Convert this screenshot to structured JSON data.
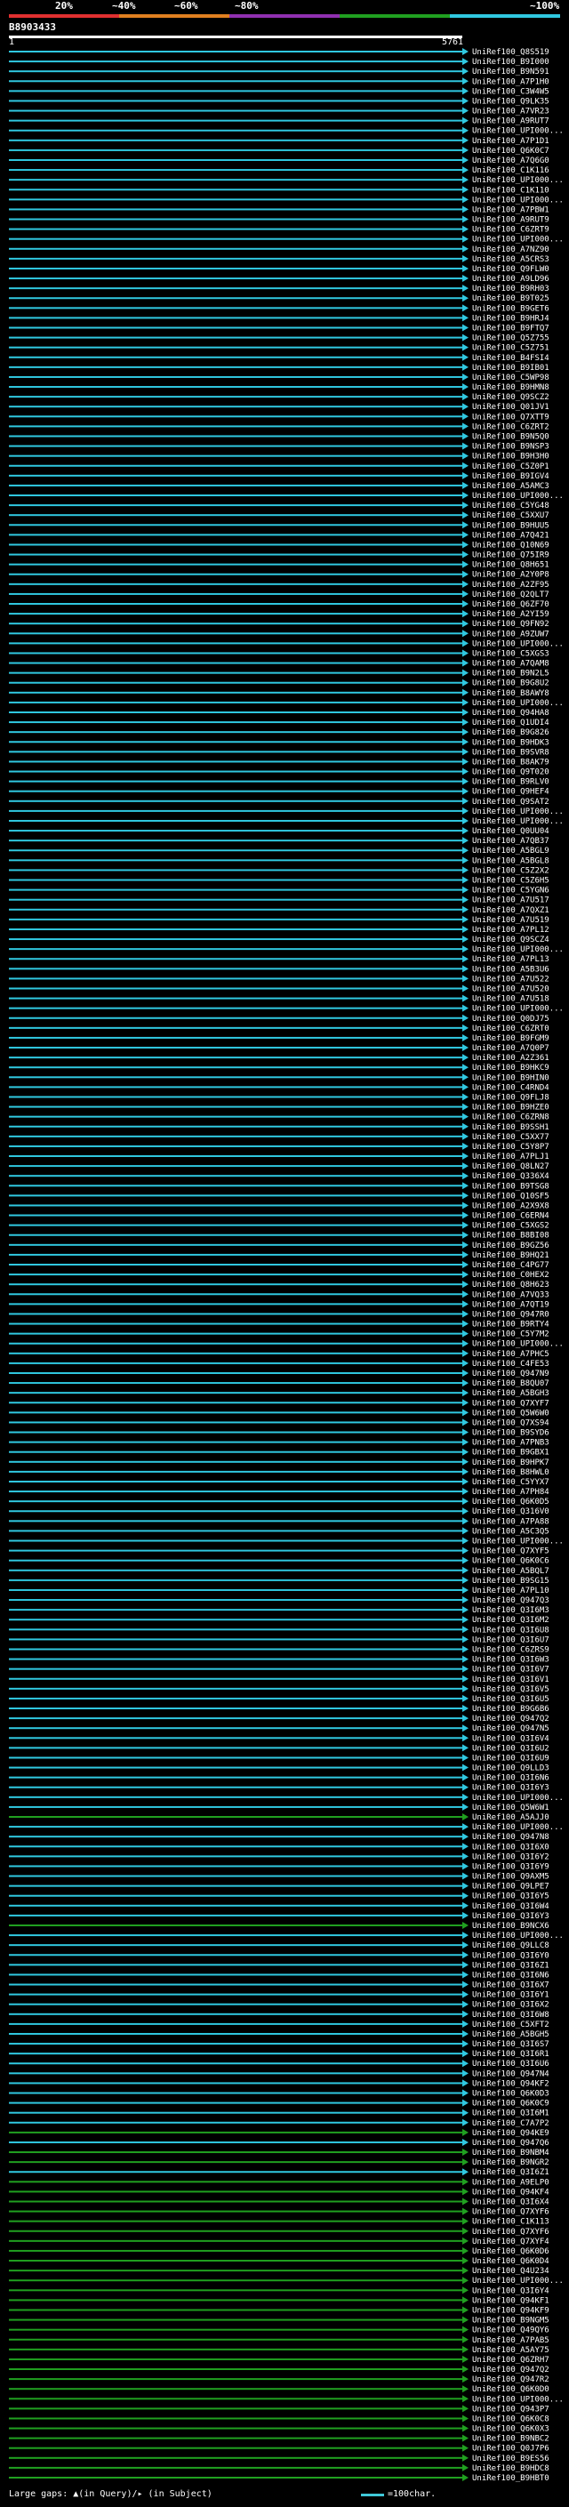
{
  "legend": {
    "labels": [
      "20%",
      "~40%",
      "~60%",
      "~80%",
      "~100%"
    ],
    "colors": [
      "#e03030",
      "#e08020",
      "#9030b0",
      "#20a020",
      "#30c8e0"
    ]
  },
  "query_id": "B8903433",
  "ruler": {
    "start": "1",
    "end": "5761"
  },
  "footer": {
    "caption": "Large gaps: ▲(in Query)/▸ (in Subject)",
    "scale": "=100char."
  },
  "chart_data": {
    "type": "alignment",
    "query_length": 5761,
    "identity_classes": {
      "cyan": "~100%",
      "green": "~80%"
    },
    "hits": [
      {
        "id": "UniRef100_Q8S519",
        "c": "cyan"
      },
      {
        "id": "UniRef100_B9I000",
        "c": "cyan"
      },
      {
        "id": "UniRef100_B9N591",
        "c": "cyan"
      },
      {
        "id": "UniRef100_A7P1H0",
        "c": "cyan"
      },
      {
        "id": "UniRef100_C3W4W5",
        "c": "cyan"
      },
      {
        "id": "UniRef100_Q9LK35",
        "c": "cyan"
      },
      {
        "id": "UniRef100_A7VR23",
        "c": "cyan"
      },
      {
        "id": "UniRef100_A9RUT7",
        "c": "cyan"
      },
      {
        "id": "UniRef100_UPI000...",
        "c": "cyan"
      },
      {
        "id": "UniRef100_A7P1D1",
        "c": "cyan"
      },
      {
        "id": "UniRef100_Q6K0C7",
        "c": "cyan"
      },
      {
        "id": "UniRef100_A7Q6G0",
        "c": "cyan"
      },
      {
        "id": "UniRef100_C1K116",
        "c": "cyan"
      },
      {
        "id": "UniRef100_UPI000...",
        "c": "cyan"
      },
      {
        "id": "UniRef100_C1K110",
        "c": "cyan"
      },
      {
        "id": "UniRef100_UPI000...",
        "c": "cyan"
      },
      {
        "id": "UniRef100_A7PBW1",
        "c": "cyan"
      },
      {
        "id": "UniRef100_A9RUT9",
        "c": "cyan"
      },
      {
        "id": "UniRef100_C6ZRT9",
        "c": "cyan"
      },
      {
        "id": "UniRef100_UPI000...",
        "c": "cyan"
      },
      {
        "id": "UniRef100_A7NZ90",
        "c": "cyan"
      },
      {
        "id": "UniRef100_A5CRS3",
        "c": "cyan"
      },
      {
        "id": "UniRef100_Q9FLW0",
        "c": "cyan"
      },
      {
        "id": "UniRef100_A9LD96",
        "c": "cyan"
      },
      {
        "id": "UniRef100_B9RH03",
        "c": "cyan"
      },
      {
        "id": "UniRef100_B9T025",
        "c": "cyan"
      },
      {
        "id": "UniRef100_B9GET6",
        "c": "cyan"
      },
      {
        "id": "UniRef100_B9HRJ4",
        "c": "cyan"
      },
      {
        "id": "UniRef100_B9FTQ7",
        "c": "cyan"
      },
      {
        "id": "UniRef100_Q5Z755",
        "c": "cyan"
      },
      {
        "id": "UniRef100_C5Z751",
        "c": "cyan"
      },
      {
        "id": "UniRef100_B4FSI4",
        "c": "cyan"
      },
      {
        "id": "UniRef100_B9IB01",
        "c": "cyan"
      },
      {
        "id": "UniRef100_C5WP98",
        "c": "cyan"
      },
      {
        "id": "UniRef100_B9HMN8",
        "c": "cyan"
      },
      {
        "id": "UniRef100_Q9SCZ2",
        "c": "cyan"
      },
      {
        "id": "UniRef100_Q01JV1",
        "c": "cyan"
      },
      {
        "id": "UniRef100_Q7XTT9",
        "c": "cyan"
      },
      {
        "id": "UniRef100_C6ZRT2",
        "c": "cyan"
      },
      {
        "id": "UniRef100_B9N5Q0",
        "c": "cyan"
      },
      {
        "id": "UniRef100_B9NSP3",
        "c": "cyan"
      },
      {
        "id": "UniRef100_B9H3H0",
        "c": "cyan"
      },
      {
        "id": "UniRef100_C5Z0P1",
        "c": "cyan"
      },
      {
        "id": "UniRef100_B9IGV4",
        "c": "cyan"
      },
      {
        "id": "UniRef100_A5AMC3",
        "c": "cyan"
      },
      {
        "id": "UniRef100_UPI000...",
        "c": "cyan"
      },
      {
        "id": "UniRef100_C5YG48",
        "c": "cyan"
      },
      {
        "id": "UniRef100_C5XXU7",
        "c": "cyan"
      },
      {
        "id": "UniRef100_B9HUU5",
        "c": "cyan"
      },
      {
        "id": "UniRef100_A7Q421",
        "c": "cyan"
      },
      {
        "id": "UniRef100_Q10N69",
        "c": "cyan"
      },
      {
        "id": "UniRef100_Q75IR9",
        "c": "cyan"
      },
      {
        "id": "UniRef100_Q8H651",
        "c": "cyan"
      },
      {
        "id": "UniRef100_A2Y0P8",
        "c": "cyan"
      },
      {
        "id": "UniRef100_A2ZF95",
        "c": "cyan"
      },
      {
        "id": "UniRef100_Q2QLT7",
        "c": "cyan"
      },
      {
        "id": "UniRef100_Q6ZF70",
        "c": "cyan"
      },
      {
        "id": "UniRef100_A2YI59",
        "c": "cyan"
      },
      {
        "id": "UniRef100_Q9FN92",
        "c": "cyan"
      },
      {
        "id": "UniRef100_A9ZUW7",
        "c": "cyan"
      },
      {
        "id": "UniRef100_UPI000...",
        "c": "cyan"
      },
      {
        "id": "UniRef100_C5XGS3",
        "c": "cyan"
      },
      {
        "id": "UniRef100_A7QAM8",
        "c": "cyan"
      },
      {
        "id": "UniRef100_B9N2L5",
        "c": "cyan"
      },
      {
        "id": "UniRef100_B9G8U2",
        "c": "cyan"
      },
      {
        "id": "UniRef100_B8AWY8",
        "c": "cyan"
      },
      {
        "id": "UniRef100_UPI000...",
        "c": "cyan"
      },
      {
        "id": "UniRef100_Q94HA8",
        "c": "cyan"
      },
      {
        "id": "UniRef100_Q1UDI4",
        "c": "cyan"
      },
      {
        "id": "UniRef100_B9G826",
        "c": "cyan"
      },
      {
        "id": "UniRef100_B9HDK3",
        "c": "cyan"
      },
      {
        "id": "UniRef100_B9SVR8",
        "c": "cyan"
      },
      {
        "id": "UniRef100_B8AK79",
        "c": "cyan"
      },
      {
        "id": "UniRef100_Q9T020",
        "c": "cyan"
      },
      {
        "id": "UniRef100_B9RLV0",
        "c": "cyan"
      },
      {
        "id": "UniRef100_Q9HEF4",
        "c": "cyan"
      },
      {
        "id": "UniRef100_Q9SAT2",
        "c": "cyan"
      },
      {
        "id": "UniRef100_UPI000...",
        "c": "cyan"
      },
      {
        "id": "UniRef100_UPI000...",
        "c": "cyan"
      },
      {
        "id": "UniRef100_Q0UU04",
        "c": "cyan"
      },
      {
        "id": "UniRef100_A7QB37",
        "c": "cyan"
      },
      {
        "id": "UniRef100_A5BGL9",
        "c": "cyan"
      },
      {
        "id": "UniRef100_A5BGL8",
        "c": "cyan"
      },
      {
        "id": "UniRef100_C5Z2X2",
        "c": "cyan"
      },
      {
        "id": "UniRef100_C5Z6H5",
        "c": "cyan"
      },
      {
        "id": "UniRef100_C5YGN6",
        "c": "cyan"
      },
      {
        "id": "UniRef100_A7U517",
        "c": "cyan"
      },
      {
        "id": "UniRef100_A7QXZ1",
        "c": "cyan"
      },
      {
        "id": "UniRef100_A7U519",
        "c": "cyan"
      },
      {
        "id": "UniRef100_A7PL12",
        "c": "cyan"
      },
      {
        "id": "UniRef100_Q9SCZ4",
        "c": "cyan"
      },
      {
        "id": "UniRef100_UPI000...",
        "c": "cyan"
      },
      {
        "id": "UniRef100_A7PL13",
        "c": "cyan"
      },
      {
        "id": "UniRef100_A5B3U6",
        "c": "cyan"
      },
      {
        "id": "UniRef100_A7U522",
        "c": "cyan"
      },
      {
        "id": "UniRef100_A7U520",
        "c": "cyan"
      },
      {
        "id": "UniRef100_A7U518",
        "c": "cyan"
      },
      {
        "id": "UniRef100_UPI000...",
        "c": "cyan"
      },
      {
        "id": "UniRef100_Q0DJ75",
        "c": "cyan"
      },
      {
        "id": "UniRef100_C6ZRT0",
        "c": "cyan"
      },
      {
        "id": "UniRef100_B9FGM9",
        "c": "cyan"
      },
      {
        "id": "UniRef100_A7Q0P7",
        "c": "cyan"
      },
      {
        "id": "UniRef100_A2Z361",
        "c": "cyan"
      },
      {
        "id": "UniRef100_B9HKC9",
        "c": "cyan"
      },
      {
        "id": "UniRef100_B9HIN0",
        "c": "cyan"
      },
      {
        "id": "UniRef100_C4RND4",
        "c": "cyan"
      },
      {
        "id": "UniRef100_Q9FLJ8",
        "c": "cyan"
      },
      {
        "id": "UniRef100_B9HZE0",
        "c": "cyan"
      },
      {
        "id": "UniRef100_C6ZRN8",
        "c": "cyan"
      },
      {
        "id": "UniRef100_B9SSH1",
        "c": "cyan"
      },
      {
        "id": "UniRef100_C5XX77",
        "c": "cyan"
      },
      {
        "id": "UniRef100_C5Y8P7",
        "c": "cyan"
      },
      {
        "id": "UniRef100_A7PLJ1",
        "c": "cyan"
      },
      {
        "id": "UniRef100_Q8LN27",
        "c": "cyan"
      },
      {
        "id": "UniRef100_Q336X4",
        "c": "cyan"
      },
      {
        "id": "UniRef100_B9TSG8",
        "c": "cyan"
      },
      {
        "id": "UniRef100_Q10SF5",
        "c": "cyan"
      },
      {
        "id": "UniRef100_A2X9X8",
        "c": "cyan"
      },
      {
        "id": "UniRef100_C6ERN4",
        "c": "cyan"
      },
      {
        "id": "UniRef100_C5XGS2",
        "c": "cyan"
      },
      {
        "id": "UniRef100_B8BI08",
        "c": "cyan"
      },
      {
        "id": "UniRef100_B9GZ56",
        "c": "cyan"
      },
      {
        "id": "UniRef100_B9HQ21",
        "c": "cyan"
      },
      {
        "id": "UniRef100_C4PG77",
        "c": "cyan"
      },
      {
        "id": "UniRef100_C0HEX2",
        "c": "cyan"
      },
      {
        "id": "UniRef100_Q8H623",
        "c": "cyan"
      },
      {
        "id": "UniRef100_A7VQ33",
        "c": "cyan"
      },
      {
        "id": "UniRef100_A7QT19",
        "c": "cyan"
      },
      {
        "id": "UniRef100_Q947R0",
        "c": "cyan"
      },
      {
        "id": "UniRef100_B9RTY4",
        "c": "cyan"
      },
      {
        "id": "UniRef100_C5Y7M2",
        "c": "cyan"
      },
      {
        "id": "UniRef100_UPI000...",
        "c": "cyan"
      },
      {
        "id": "UniRef100_A7PHC5",
        "c": "cyan"
      },
      {
        "id": "UniRef100_C4FE53",
        "c": "cyan"
      },
      {
        "id": "UniRef100_Q947N9",
        "c": "cyan"
      },
      {
        "id": "UniRef100_B8QU07",
        "c": "cyan"
      },
      {
        "id": "UniRef100_A5BGH3",
        "c": "cyan"
      },
      {
        "id": "UniRef100_Q7XYF7",
        "c": "cyan"
      },
      {
        "id": "UniRef100_Q5W6W0",
        "c": "cyan"
      },
      {
        "id": "UniRef100_Q7XS94",
        "c": "cyan"
      },
      {
        "id": "UniRef100_B9SYD6",
        "c": "cyan"
      },
      {
        "id": "UniRef100_A7PNB3",
        "c": "cyan"
      },
      {
        "id": "UniRef100_B9GBX1",
        "c": "cyan"
      },
      {
        "id": "UniRef100_B9HPK7",
        "c": "cyan"
      },
      {
        "id": "UniRef100_B8HWL0",
        "c": "cyan"
      },
      {
        "id": "UniRef100_C5YYX7",
        "c": "cyan"
      },
      {
        "id": "UniRef100_A7PH84",
        "c": "cyan"
      },
      {
        "id": "UniRef100_Q6K0D5",
        "c": "cyan"
      },
      {
        "id": "UniRef100_Q316V0",
        "c": "cyan"
      },
      {
        "id": "UniRef100_A7PA88",
        "c": "cyan"
      },
      {
        "id": "UniRef100_A5C3Q5",
        "c": "cyan"
      },
      {
        "id": "UniRef100_UPI000...",
        "c": "cyan"
      },
      {
        "id": "UniRef100_Q7XYF5",
        "c": "cyan"
      },
      {
        "id": "UniRef100_Q6K0C6",
        "c": "cyan"
      },
      {
        "id": "UniRef100_A5BQL7",
        "c": "cyan"
      },
      {
        "id": "UniRef100_B9SG15",
        "c": "cyan"
      },
      {
        "id": "UniRef100_A7PL10",
        "c": "cyan"
      },
      {
        "id": "UniRef100_Q947Q3",
        "c": "cyan"
      },
      {
        "id": "UniRef100_Q3I6M3",
        "c": "cyan"
      },
      {
        "id": "UniRef100_Q3I6M2",
        "c": "cyan"
      },
      {
        "id": "UniRef100_Q3I6U8",
        "c": "cyan"
      },
      {
        "id": "UniRef100_Q3I6U7",
        "c": "cyan"
      },
      {
        "id": "UniRef100_C6ZRS9",
        "c": "cyan"
      },
      {
        "id": "UniRef100_Q3I6W3",
        "c": "cyan"
      },
      {
        "id": "UniRef100_Q3I6V7",
        "c": "cyan"
      },
      {
        "id": "UniRef100_Q3I6V1",
        "c": "cyan"
      },
      {
        "id": "UniRef100_Q3I6V5",
        "c": "cyan"
      },
      {
        "id": "UniRef100_Q3I6U5",
        "c": "cyan"
      },
      {
        "id": "UniRef100_B9G6B6",
        "c": "cyan"
      },
      {
        "id": "UniRef100_Q947Q2",
        "c": "cyan"
      },
      {
        "id": "UniRef100_Q947N5",
        "c": "cyan"
      },
      {
        "id": "UniRef100_Q3I6V4",
        "c": "cyan"
      },
      {
        "id": "UniRef100_Q3I6U2",
        "c": "cyan"
      },
      {
        "id": "UniRef100_Q3I6U9",
        "c": "cyan"
      },
      {
        "id": "UniRef100_Q9LLD3",
        "c": "cyan"
      },
      {
        "id": "UniRef100_Q3I6N6",
        "c": "cyan"
      },
      {
        "id": "UniRef100_Q3I6Y3",
        "c": "cyan"
      },
      {
        "id": "UniRef100_UPI000...",
        "c": "cyan"
      },
      {
        "id": "UniRef100_Q5W6W1",
        "c": "cyan"
      },
      {
        "id": "UniRef100_A5AJJ0",
        "c": "green"
      },
      {
        "id": "UniRef100_UPI000...",
        "c": "cyan"
      },
      {
        "id": "UniRef100_Q947N8",
        "c": "cyan"
      },
      {
        "id": "UniRef100_Q3I6X0",
        "c": "cyan"
      },
      {
        "id": "UniRef100_Q3I6Y2",
        "c": "cyan"
      },
      {
        "id": "UniRef100_Q3I6Y9",
        "c": "cyan"
      },
      {
        "id": "UniRef100_Q9AXM5",
        "c": "cyan"
      },
      {
        "id": "UniRef100_Q9LPE7",
        "c": "cyan"
      },
      {
        "id": "UniRef100_Q3I6Y5",
        "c": "cyan"
      },
      {
        "id": "UniRef100_Q3I6W4",
        "c": "cyan"
      },
      {
        "id": "UniRef100_Q3I6Y3",
        "c": "cyan"
      },
      {
        "id": "UniRef100_B9NCX6",
        "c": "green"
      },
      {
        "id": "UniRef100_UPI000...",
        "c": "cyan"
      },
      {
        "id": "UniRef100_Q9LLC8",
        "c": "cyan"
      },
      {
        "id": "UniRef100_Q3I6Y0",
        "c": "cyan"
      },
      {
        "id": "UniRef100_Q3I6Z1",
        "c": "cyan"
      },
      {
        "id": "UniRef100_Q3I6N6",
        "c": "cyan"
      },
      {
        "id": "UniRef100_Q3I6X7",
        "c": "cyan"
      },
      {
        "id": "UniRef100_Q3I6Y1",
        "c": "cyan"
      },
      {
        "id": "UniRef100_Q3I6X2",
        "c": "cyan"
      },
      {
        "id": "UniRef100_Q3I6W8",
        "c": "cyan"
      },
      {
        "id": "UniRef100_C5XFT2",
        "c": "cyan"
      },
      {
        "id": "UniRef100_A5BGH5",
        "c": "cyan"
      },
      {
        "id": "UniRef100_Q3I6S7",
        "c": "cyan"
      },
      {
        "id": "UniRef100_Q3I6R1",
        "c": "cyan"
      },
      {
        "id": "UniRef100_Q3I6U6",
        "c": "cyan"
      },
      {
        "id": "UniRef100_Q947N4",
        "c": "cyan"
      },
      {
        "id": "UniRef100_Q94KF2",
        "c": "cyan"
      },
      {
        "id": "UniRef100_Q6K0D3",
        "c": "cyan"
      },
      {
        "id": "UniRef100_Q6K0C9",
        "c": "cyan"
      },
      {
        "id": "UniRef100_Q3I6M1",
        "c": "cyan"
      },
      {
        "id": "UniRef100_C7A7P2",
        "c": "cyan"
      },
      {
        "id": "UniRef100_Q94KE9",
        "c": "green"
      },
      {
        "id": "UniRef100_Q947Q6",
        "c": "cyan"
      },
      {
        "id": "UniRef100_B9NBM4",
        "c": "green"
      },
      {
        "id": "UniRef100_B9NGR2",
        "c": "green"
      },
      {
        "id": "UniRef100_Q3I6Z1",
        "c": "cyan"
      },
      {
        "id": "UniRef100_A9ELP0",
        "c": "green"
      },
      {
        "id": "UniRef100_Q94KF4",
        "c": "green"
      },
      {
        "id": "UniRef100_Q3I6X4",
        "c": "green"
      },
      {
        "id": "UniRef100_Q7XYF6",
        "c": "green"
      },
      {
        "id": "UniRef100_C1K113",
        "c": "green"
      },
      {
        "id": "UniRef100_Q7XYF6",
        "c": "green"
      },
      {
        "id": "UniRef100_Q7XYF4",
        "c": "green"
      },
      {
        "id": "UniRef100_Q6K0D6",
        "c": "green"
      },
      {
        "id": "UniRef100_Q6K0D4",
        "c": "green"
      },
      {
        "id": "UniRef100_Q4U234",
        "c": "green"
      },
      {
        "id": "UniRef100_UPI000...",
        "c": "green"
      },
      {
        "id": "UniRef100_Q3I6Y4",
        "c": "green"
      },
      {
        "id": "UniRef100_Q94KF1",
        "c": "green"
      },
      {
        "id": "UniRef100_Q94KF9",
        "c": "green"
      },
      {
        "id": "UniRef100_B9NGM5",
        "c": "green"
      },
      {
        "id": "UniRef100_Q49QY6",
        "c": "green"
      },
      {
        "id": "UniRef100_A7PAB5",
        "c": "green"
      },
      {
        "id": "UniRef100_A5AY75",
        "c": "green"
      },
      {
        "id": "UniRef100_Q6ZRH7",
        "c": "green"
      },
      {
        "id": "UniRef100_Q947Q2",
        "c": "green"
      },
      {
        "id": "UniRef100_Q947R2",
        "c": "green"
      },
      {
        "id": "UniRef100_Q6K0D0",
        "c": "green"
      },
      {
        "id": "UniRef100_UPI000...",
        "c": "green"
      },
      {
        "id": "UniRef100_Q943P7",
        "c": "green"
      },
      {
        "id": "UniRef100_Q6K0C8",
        "c": "green"
      },
      {
        "id": "UniRef100_Q6K0X3",
        "c": "green"
      },
      {
        "id": "UniRef100_B9NBC2",
        "c": "green"
      },
      {
        "id": "UniRef100_Q0J7P6",
        "c": "green"
      },
      {
        "id": "UniRef100_B9ES56",
        "c": "green"
      },
      {
        "id": "UniRef100_B9HDC8",
        "c": "green"
      },
      {
        "id": "UniRef100_B9HBT0",
        "c": "green"
      }
    ]
  }
}
